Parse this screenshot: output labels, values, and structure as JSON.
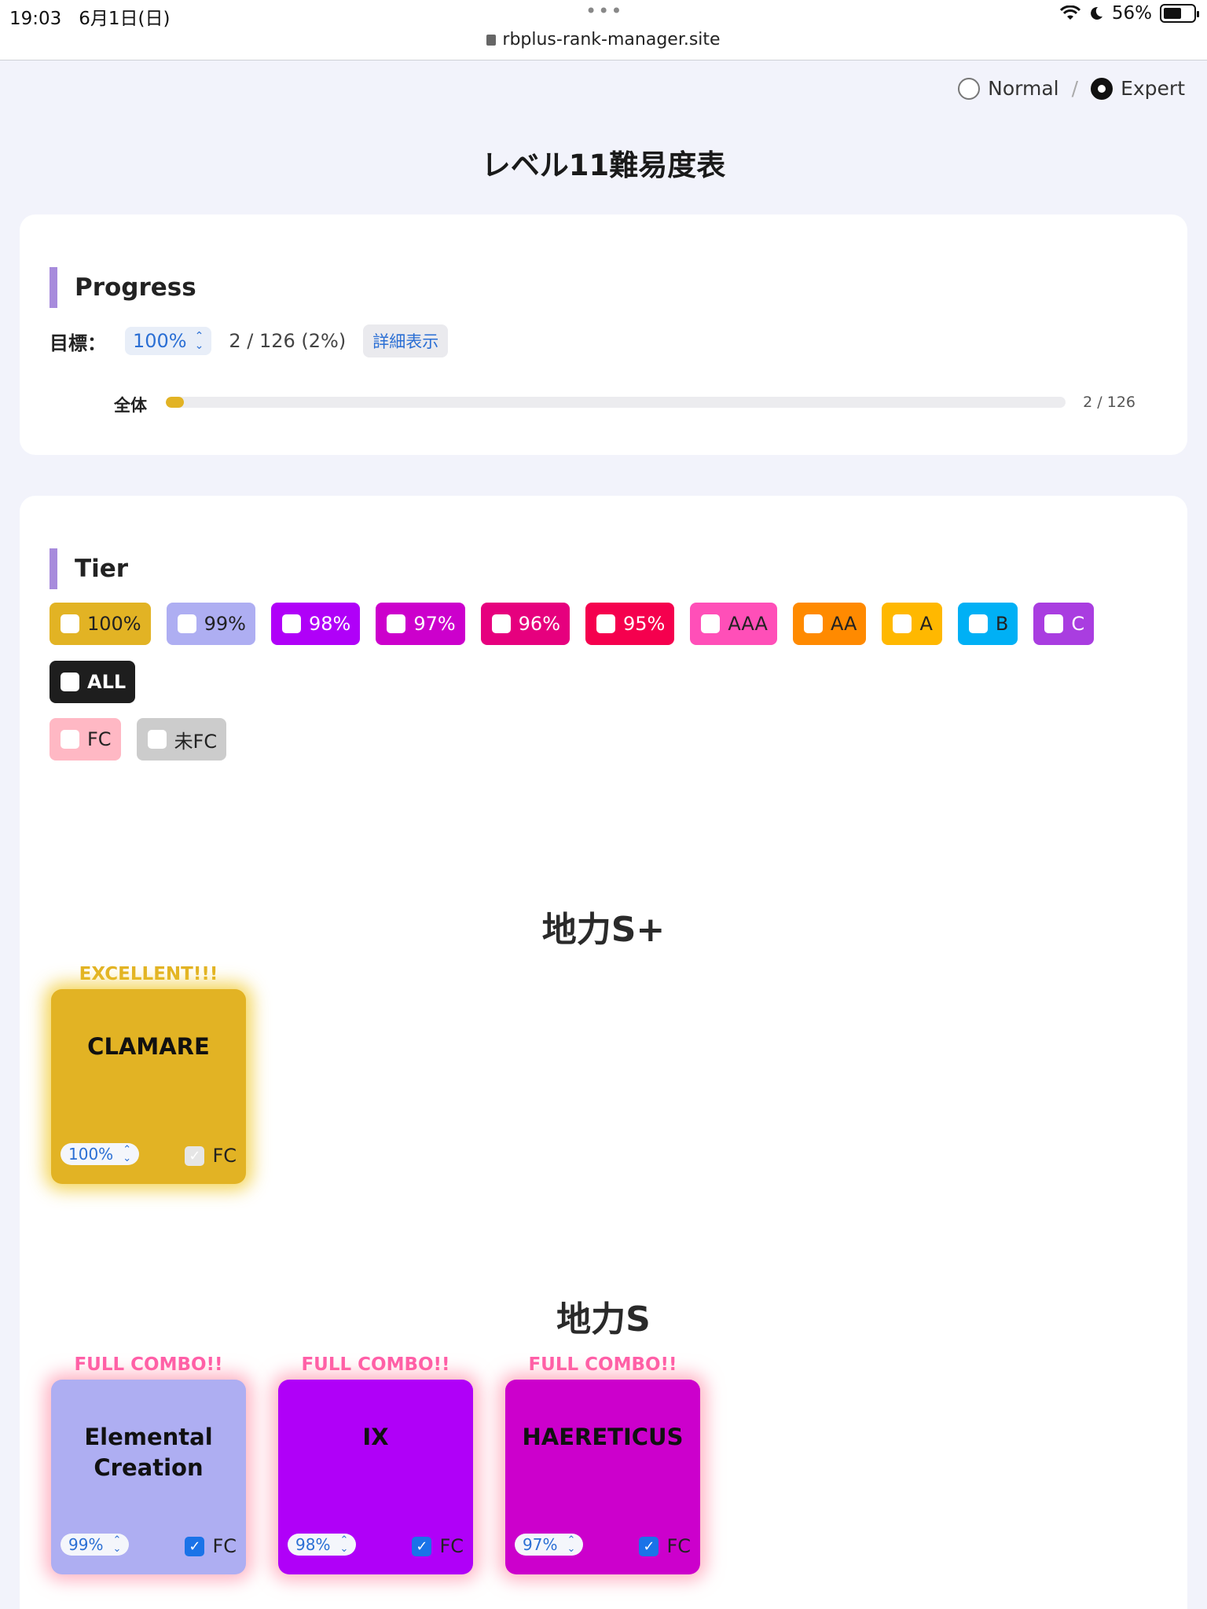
{
  "status_bar": {
    "time": "19:03",
    "date": "6月1日(日)",
    "dots": "•••",
    "url": "rbplus-rank-manager.site",
    "battery": "56%"
  },
  "mode": {
    "normal_label": "Normal",
    "separator": "/",
    "expert_label": "Expert",
    "selected": "Expert"
  },
  "page_title": "レベル11難易度表",
  "progress": {
    "heading": "Progress",
    "goal_label": "目標：",
    "goal_value": "100%",
    "count_text": "2 / 126 (2%)",
    "detail_button": "詳細表示",
    "bar_label": "全体",
    "bar_count": "2 / 126",
    "bar_fraction": 0.02,
    "bar_color": "#e2b324"
  },
  "tier": {
    "heading": "Tier",
    "rank_filters": [
      {
        "label": "100%",
        "color": "#e2b324",
        "text_color": "#222222"
      },
      {
        "label": "99%",
        "color": "#aeaef2",
        "text_color": "#222222"
      },
      {
        "label": "98%",
        "color": "#b000f8",
        "text_color": "#ffffff"
      },
      {
        "label": "97%",
        "color": "#cc00cc",
        "text_color": "#ffffff"
      },
      {
        "label": "96%",
        "color": "#e6007e",
        "text_color": "#ffffff"
      },
      {
        "label": "95%",
        "color": "#f5004e",
        "text_color": "#ffffff"
      },
      {
        "label": "AAA",
        "color": "#ff4fb8",
        "text_color": "#222222"
      },
      {
        "label": "AA",
        "color": "#ff8a00",
        "text_color": "#222222"
      },
      {
        "label": "A",
        "color": "#ffb800",
        "text_color": "#222222"
      },
      {
        "label": "B",
        "color": "#00b0f5",
        "text_color": "#222222"
      },
      {
        "label": "C",
        "color": "#a93de0",
        "text_color": "#ffffff"
      },
      {
        "label": "ALL",
        "color": "#1e1e1e",
        "text_color": "#ffffff"
      }
    ],
    "fc_filters": [
      {
        "label": "FC",
        "color": "#ffb8c4",
        "text_color": "#222222"
      },
      {
        "label": "未FC",
        "color": "#cccccc",
        "text_color": "#222222"
      }
    ],
    "groups": [
      {
        "title": "地力S+",
        "songs": [
          {
            "name": "CLAMARE",
            "banner": "EXCELLENT!!!",
            "banner_color": "#e2b324",
            "tile_color": "#e2b324",
            "glow": "rgba(240,200,40,0.75)",
            "rank": "100%",
            "fc_label": "FC",
            "fc_checked": true,
            "fc_style": "gray"
          }
        ]
      },
      {
        "title": "地力S",
        "songs": [
          {
            "name": "Elemental Creation",
            "banner": "FULL COMBO!!",
            "banner_color": "#ff5fa8",
            "tile_color": "#aeaef2",
            "glow": "rgba(255,120,150,0.55)",
            "rank": "99%",
            "fc_label": "FC",
            "fc_checked": true,
            "fc_style": "blue"
          },
          {
            "name": "IX",
            "banner": "FULL COMBO!!",
            "banner_color": "#ff5fa8",
            "tile_color": "#b000f8",
            "glow": "rgba(255,120,150,0.55)",
            "rank": "98%",
            "fc_label": "FC",
            "fc_checked": true,
            "fc_style": "blue"
          },
          {
            "name": "HAERETICUS",
            "banner": "FULL COMBO!!",
            "banner_color": "#ff5fa8",
            "tile_color": "#cc00cc",
            "glow": "rgba(255,120,150,0.55)",
            "rank": "97%",
            "fc_label": "FC",
            "fc_checked": true,
            "fc_style": "blue"
          }
        ]
      }
    ]
  }
}
